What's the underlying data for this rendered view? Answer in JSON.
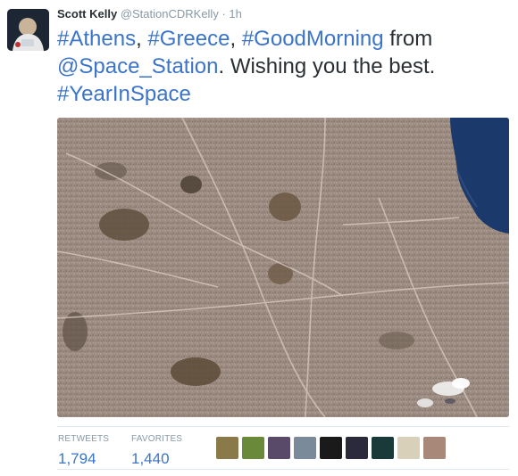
{
  "tweet": {
    "author_name": "Scott Kelly",
    "handle": "@StationCDRKelly",
    "separator": "·",
    "time": "1h",
    "text": {
      "hashtag_athens": "#Athens",
      "comma_1": ", ",
      "hashtag_greece": "#Greece",
      "comma_2": ", ",
      "hashtag_goodmorning": "#GoodMorning",
      "from": " from ",
      "mention_space_station": "@Space_Station",
      "wishing": ". Wishing you the best. ",
      "hashtag_yearinspace": "#YearInSpace"
    }
  },
  "stats": {
    "retweets_label": "RETWEETS",
    "retweets_count": "1,794",
    "favorites_label": "FAVORITES",
    "favorites_count": "1,440"
  },
  "favoriters": [
    {
      "name": "favoriter-avatar",
      "color": "#8a7a4a"
    },
    {
      "name": "favoriter-avatar",
      "color": "#6a8a3a"
    },
    {
      "name": "favoriter-avatar",
      "color": "#5a4a6a"
    },
    {
      "name": "favoriter-avatar",
      "color": "#7a8a9a"
    },
    {
      "name": "favoriter-avatar",
      "color": "#1a1a1a"
    },
    {
      "name": "favoriter-avatar",
      "color": "#2a2a3a"
    },
    {
      "name": "favoriter-avatar",
      "color": "#1a3a3a"
    },
    {
      "name": "favoriter-avatar",
      "color": "#d8d0b8"
    },
    {
      "name": "favoriter-avatar",
      "color": "#a88878"
    }
  ],
  "colors": {
    "link": "#3b74c8",
    "meta": "#8899a6",
    "text": "#292f33",
    "urban": "#9b8a80",
    "sea": "#1b3a6b"
  }
}
